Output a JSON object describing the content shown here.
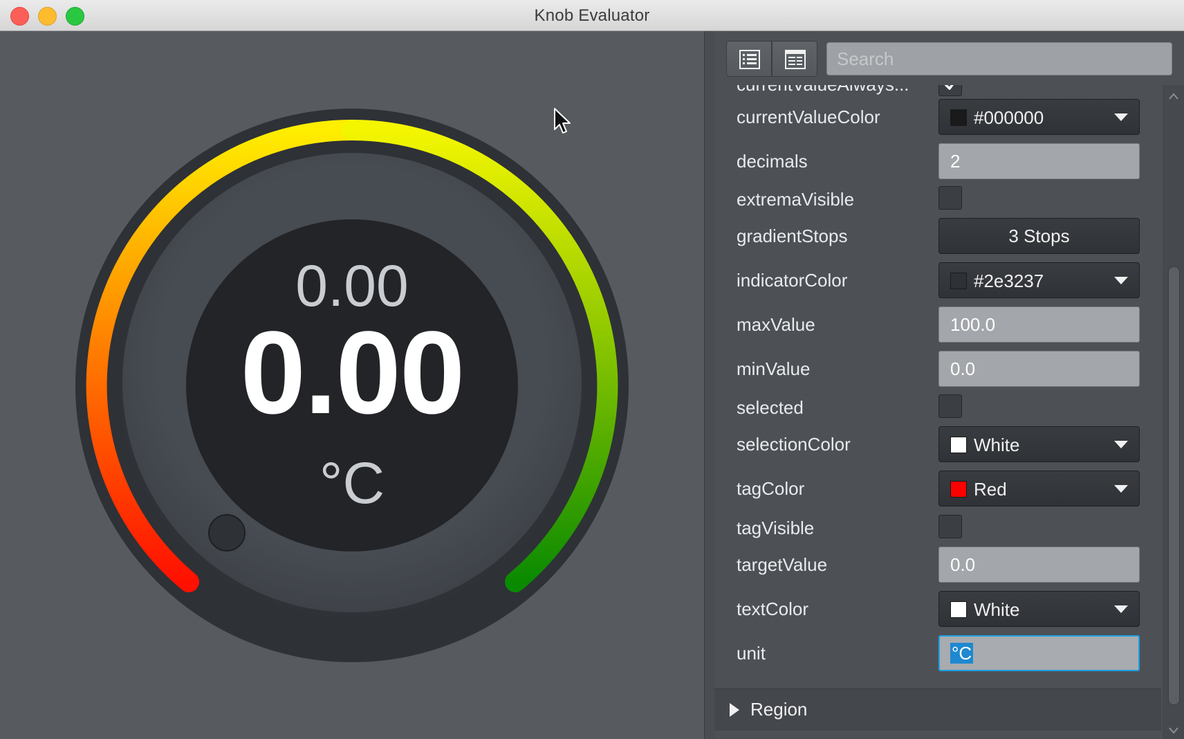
{
  "window": {
    "title": "Knob Evaluator"
  },
  "gauge": {
    "target_text": "0.00",
    "value_text": "0.00",
    "unit": "°C"
  },
  "toolbar": {
    "search_placeholder": "Search"
  },
  "properties": [
    {
      "name": "currentValueAlways...",
      "type": "checkbox",
      "checked": true
    },
    {
      "name": "currentValueColor",
      "type": "color",
      "value": "#000000",
      "swatch": "#1a1a1a"
    },
    {
      "name": "decimals",
      "type": "text",
      "value": "2"
    },
    {
      "name": "extremaVisible",
      "type": "checkbox",
      "checked": false
    },
    {
      "name": "gradientStops",
      "type": "button",
      "value": "3 Stops"
    },
    {
      "name": "indicatorColor",
      "type": "color",
      "value": "#2e3237",
      "swatch": "#2e3237"
    },
    {
      "name": "maxValue",
      "type": "text",
      "value": "100.0"
    },
    {
      "name": "minValue",
      "type": "text",
      "value": "0.0"
    },
    {
      "name": "selected",
      "type": "checkbox",
      "checked": false
    },
    {
      "name": "selectionColor",
      "type": "color",
      "value": "White",
      "swatch": "#ffffff"
    },
    {
      "name": "tagColor",
      "type": "color",
      "value": "Red",
      "swatch": "#ff0000"
    },
    {
      "name": "tagVisible",
      "type": "checkbox",
      "checked": false
    },
    {
      "name": "targetValue",
      "type": "text",
      "value": "0.0"
    },
    {
      "name": "textColor",
      "type": "color",
      "value": "White",
      "swatch": "#ffffff"
    },
    {
      "name": "unit",
      "type": "text",
      "value": "°C",
      "focused": true
    }
  ],
  "region": {
    "label": "Region"
  },
  "colors": {
    "gauge_gradient": [
      "#ff0000",
      "#ffff00",
      "#008000"
    ],
    "focus": "#1ea0e6"
  }
}
